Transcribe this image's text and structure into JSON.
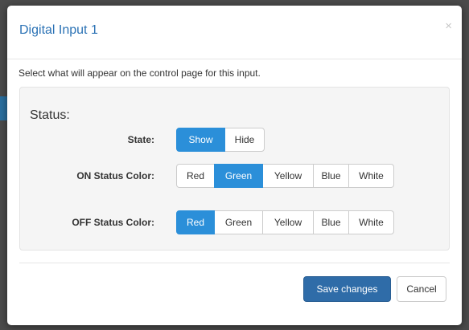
{
  "modal": {
    "title": "Digital Input 1",
    "close_glyph": "×",
    "intro": "Select what will appear on the control page for this input."
  },
  "status": {
    "heading": "Status:",
    "state": {
      "label": "State:",
      "options": [
        "Show",
        "Hide"
      ],
      "selected": "Show"
    },
    "on_color": {
      "label": "ON Status Color:",
      "options": [
        "Red",
        "Green",
        "Yellow",
        "Blue",
        "White"
      ],
      "selected": "Green"
    },
    "off_color": {
      "label": "OFF Status Color:",
      "options": [
        "Red",
        "Green",
        "Yellow",
        "Blue",
        "White"
      ],
      "selected": "Red"
    }
  },
  "footer": {
    "save_label": "Save changes",
    "cancel_label": "Cancel"
  },
  "colors": {
    "title": "#2b72b5",
    "active_button": "#2b8fd9",
    "primary_button": "#2f6ca8"
  }
}
